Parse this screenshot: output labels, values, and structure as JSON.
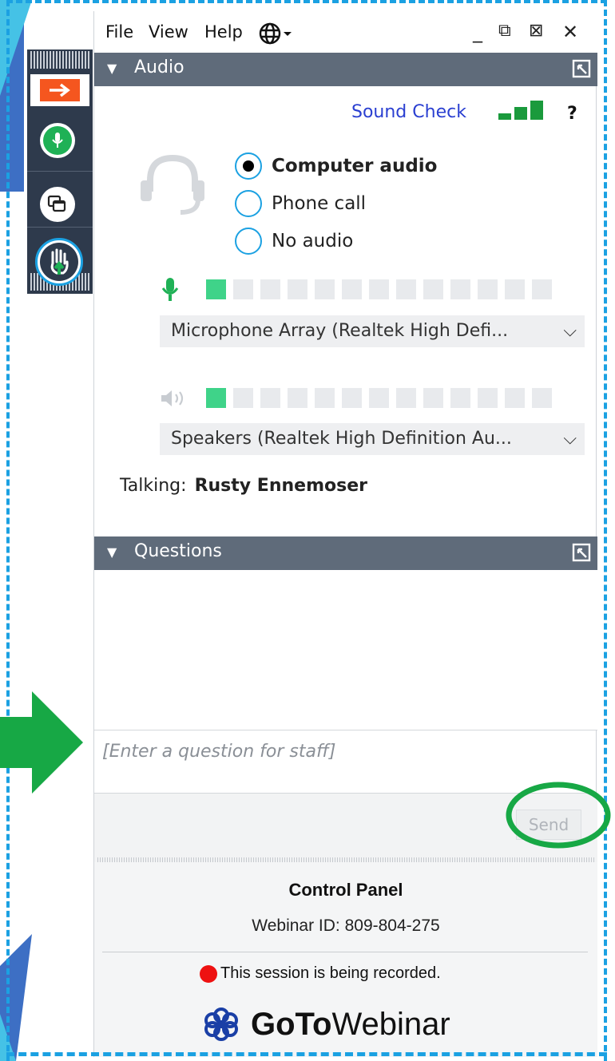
{
  "menu": {
    "file": "File",
    "view": "View",
    "help": "Help"
  },
  "window_controls": {
    "minimize": "_",
    "popout": "⧉",
    "maximize": "⊠",
    "close": "✕"
  },
  "audio": {
    "header": "Audio",
    "sound_check": "Sound Check",
    "help": "?",
    "options": [
      {
        "label": "Computer audio",
        "selected": true
      },
      {
        "label": "Phone call",
        "selected": false
      },
      {
        "label": "No audio",
        "selected": false
      }
    ],
    "microphone_level_active": 1,
    "microphone_level_total": 13,
    "speaker_level_active": 1,
    "speaker_level_total": 13,
    "microphone_device": "Microphone Array (Realtek High Defi...",
    "speaker_device": "Speakers (Realtek High Definition Au...",
    "talking_label": "Talking:",
    "talking_name": "Rusty Ennemoser"
  },
  "questions": {
    "header": "Questions",
    "placeholder": "[Enter a question for staff]",
    "send_label": "Send"
  },
  "footer": {
    "title": "Control Panel",
    "webinar_id": "Webinar ID: 809-804-275",
    "recording_notice": "This session is being recorded.",
    "brand_goto": "GoTo",
    "brand_webinar": "Webinar"
  },
  "colors": {
    "header_bg": "#5f6b7a",
    "toolbar_bg": "#2e3a4c",
    "accent_blue": "#1ba1e2",
    "sound_check_link": "#2a3fd1",
    "level_on": "#3fd389",
    "mic_green": "#1fb156",
    "annotation_green": "#17a845",
    "orange": "#f5561f"
  }
}
